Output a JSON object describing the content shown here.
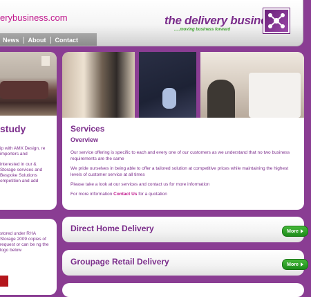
{
  "header": {
    "site_url": "erybusiness.com",
    "nav": [
      "News",
      "About",
      "Contact"
    ],
    "logo_text": "the delivery business",
    "logo_tagline": ".....moving business forward"
  },
  "left_column": {
    "heading": "study",
    "paragraphs": [
      "ip with AMX Design, re importers and",
      "interested in our & Storage services and Bespoke Solutions ompetition and add"
    ],
    "lower_text": "stored under RHA Storage 2009 copies of request or can be ng the logo below"
  },
  "main": {
    "services_title": "Services",
    "overview_title": "Overview",
    "para1": "Our service offering is specific to each and every one of our customers as we understand that no two business requirements are the same",
    "para2": "We pride ourselves in being able to offer a tailored solution at competitive prices while maintaining the highest levels of customer service at all times",
    "para3": "Please take a look at our services and contact us for more information",
    "para4_before": "For more information ",
    "para4_link": "Contact Us",
    "para4_after": " for a quotation"
  },
  "bars": [
    {
      "title": "Direct Home Delivery",
      "button": "More"
    },
    {
      "title": "Groupage Retail Delivery",
      "button": "More"
    }
  ],
  "colors": {
    "background": "#8a3d93",
    "brand_purple": "#7b2d8b",
    "accent_pink": "#c0168c",
    "button_green": "#2e9e26"
  }
}
